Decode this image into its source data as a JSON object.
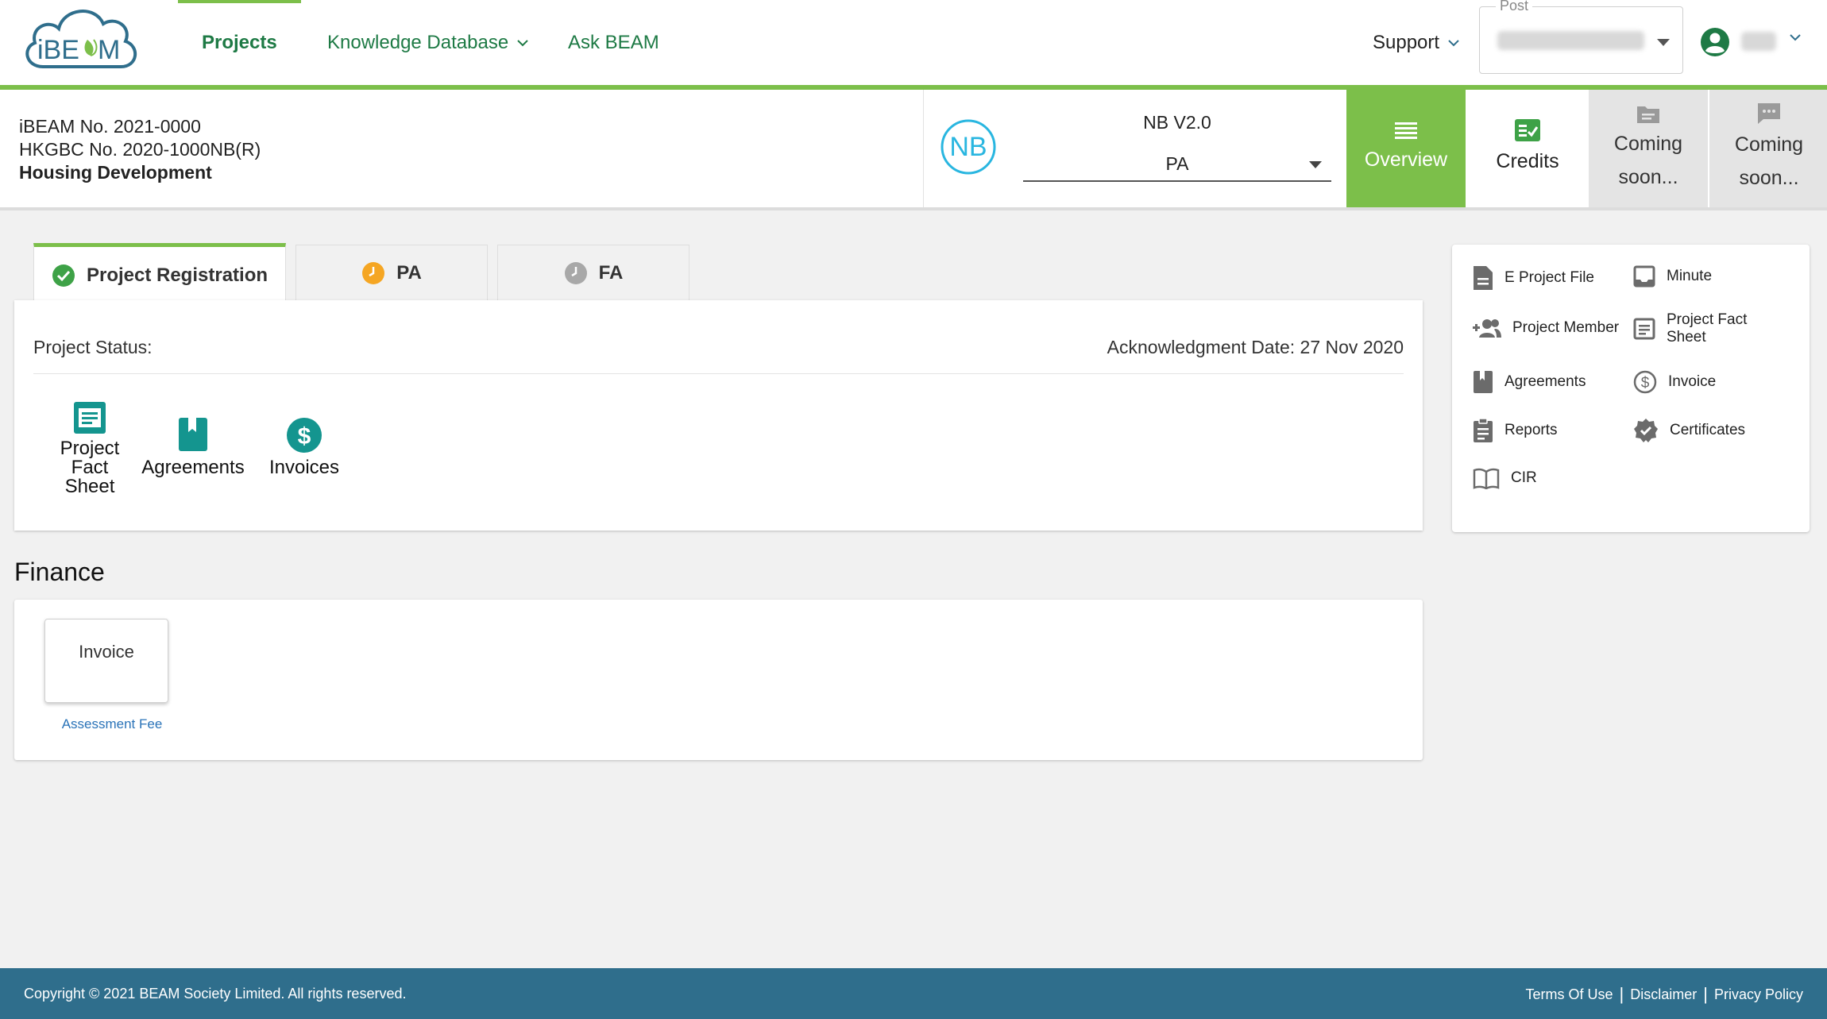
{
  "header": {
    "logo_text": "iBEAM",
    "nav": {
      "projects": "Projects",
      "knowledge": "Knowledge Database",
      "ask": "Ask BEAM"
    },
    "support": "Support",
    "post_label": "Post"
  },
  "project": {
    "ibeam_no": "iBEAM No. 2021-0000",
    "hkgbc_no": "HKGBC No. 2020-1000NB(R)",
    "type": "Housing Development",
    "scheme_logo": "NB",
    "scheme_version": "NB V2.0",
    "stage_selected": "PA"
  },
  "project_tabs": [
    {
      "label": "Overview",
      "icon": "list-icon"
    },
    {
      "label": "Credits",
      "icon": "checklist-icon"
    },
    {
      "label": "Coming soon...",
      "icon": "folder-icon"
    },
    {
      "label": "Coming soon...",
      "icon": "chat-icon"
    }
  ],
  "stage_tabs": [
    {
      "label": "Project Registration",
      "icon": "check-circle-icon"
    },
    {
      "label": "PA",
      "icon": "clock-icon"
    },
    {
      "label": "FA",
      "icon": "clock-icon"
    }
  ],
  "status": {
    "label": "Project Status:",
    "ack_date": "Acknowledgment Date: 27 Nov 2020",
    "docs": [
      {
        "line1": "Project",
        "line2": "Fact",
        "line3": "Sheet"
      },
      {
        "line1": "Agreements"
      },
      {
        "line1": "Invoices"
      }
    ]
  },
  "side_links": [
    "E Project File",
    "Minute",
    "Project Member",
    "Project Fact Sheet",
    "Agreements",
    "Invoice",
    "Reports",
    "Certificates",
    "CIR"
  ],
  "side_links_fact_sheet": {
    "l1": "Project Fact",
    "l2": "Sheet"
  },
  "finance": {
    "title": "Finance",
    "invoice_label": "Invoice",
    "invoice_link": "Assessment Fee"
  },
  "footer": {
    "copyright": "Copyright © 2021 BEAM Society Limited. All rights reserved.",
    "links": [
      "Terms Of Use",
      "Disclaimer",
      "Privacy Policy"
    ]
  },
  "colors": {
    "brand_green": "#7cbf4a",
    "nav_green": "#1e7a45",
    "teal": "#14958f",
    "footer_blue": "#2f6e8c",
    "link_blue": "#2a73b8",
    "pending_orange": "#f5a623"
  }
}
